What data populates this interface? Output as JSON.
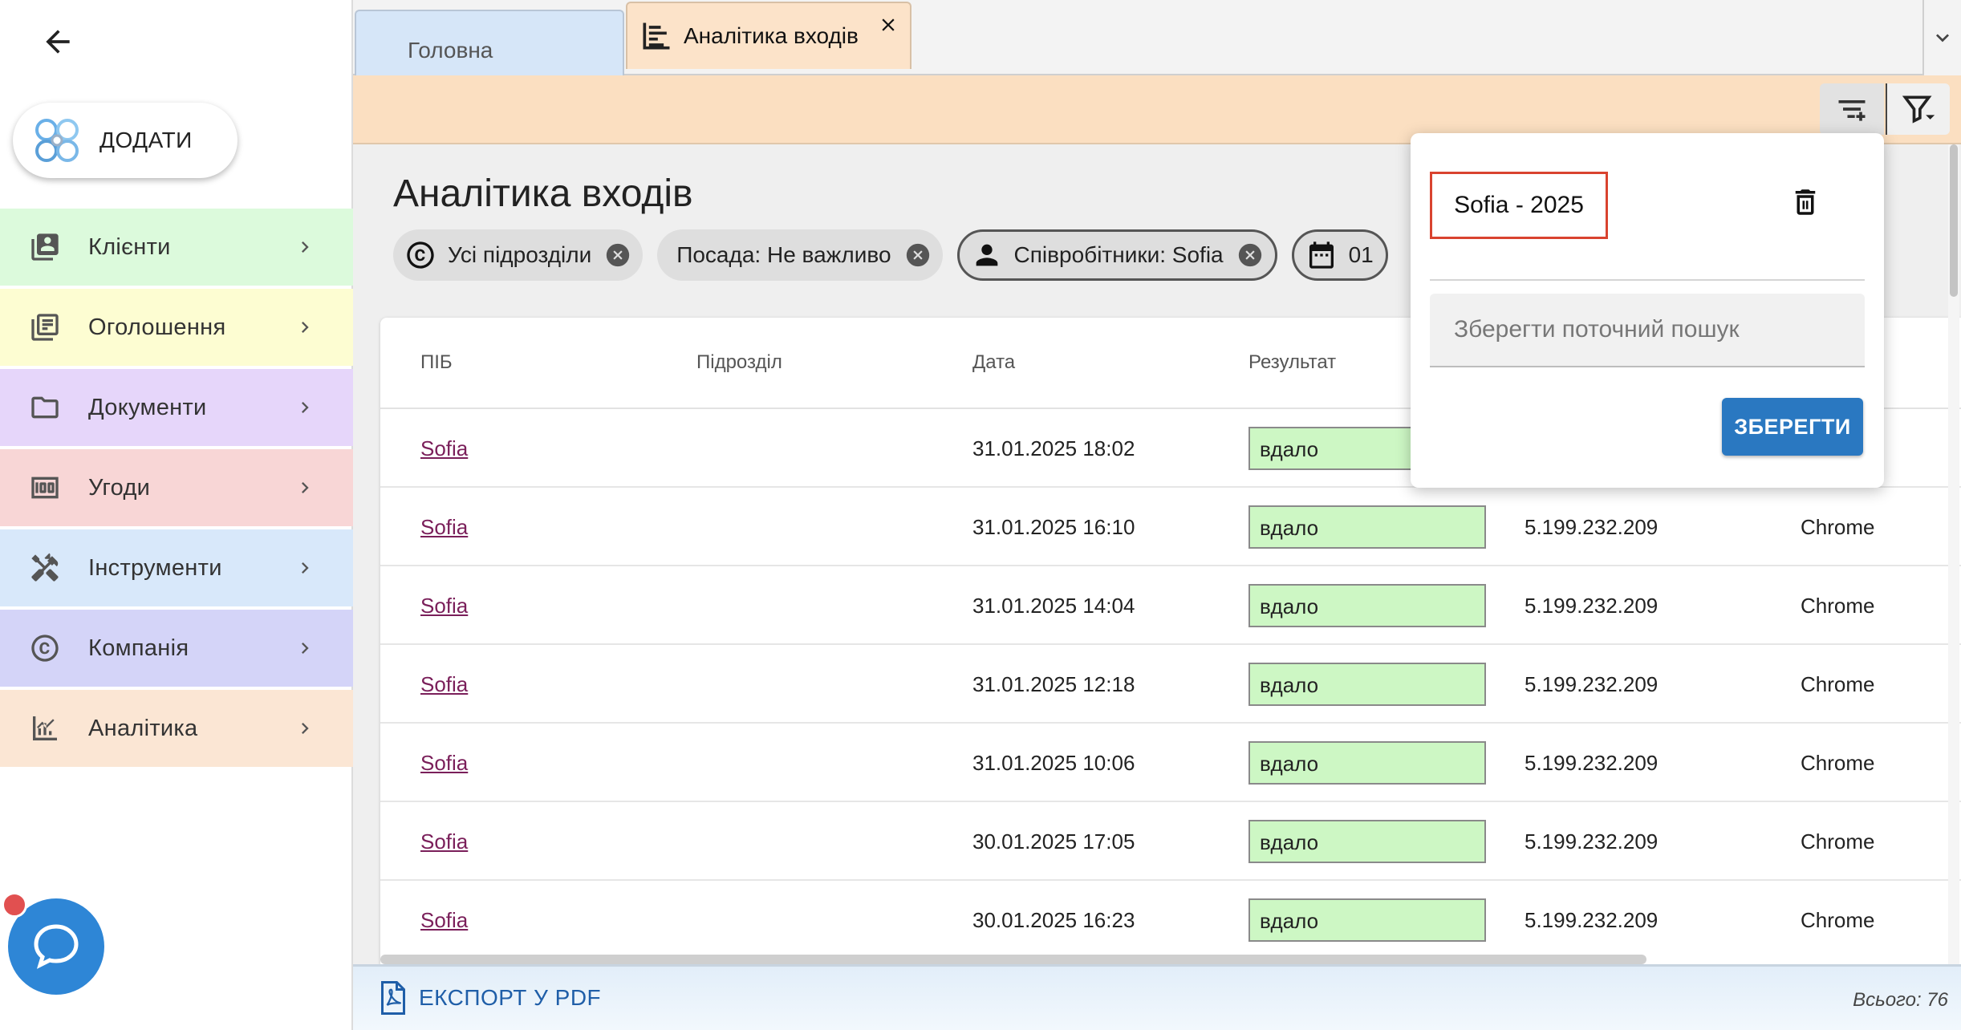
{
  "sidebar": {
    "add_label": "ДОДАТИ",
    "items": [
      {
        "label": "Клієнти",
        "icon": "contacts-icon",
        "bg": "#dcfadc"
      },
      {
        "label": "Оголошення",
        "icon": "listing-icon",
        "bg": "#fdfdd2"
      },
      {
        "label": "Документи",
        "icon": "folder-icon",
        "bg": "#e6d6fa"
      },
      {
        "label": "Угоди",
        "icon": "money-icon",
        "bg": "#f8d6d6"
      },
      {
        "label": "Інструменти",
        "icon": "tools-icon",
        "bg": "#d8e8fa"
      },
      {
        "label": "Компанія",
        "icon": "copyright-icon",
        "bg": "#d4d4f8"
      },
      {
        "label": "Аналітика",
        "icon": "analytics-icon",
        "bg": "#fbe6d4"
      }
    ]
  },
  "tabs": {
    "home_label": "Головна",
    "active_label": "Аналітика входів"
  },
  "page": {
    "title": "Аналітика входів",
    "chips": {
      "subdivisions": "Усі підрозділи",
      "position": "Посада: Не важливо",
      "employees": "Співробітники: Sofia",
      "date": "01"
    }
  },
  "table": {
    "columns": [
      "ПІБ",
      "Підрозділ",
      "Дата",
      "Результат"
    ],
    "rows": [
      {
        "name": "Sofia",
        "date": "31.01.2025 18:02",
        "result": "вдало",
        "ip": "",
        "browser": ""
      },
      {
        "name": "Sofia",
        "date": "31.01.2025 16:10",
        "result": "вдало",
        "ip": "5.199.232.209",
        "browser": "Chrome"
      },
      {
        "name": "Sofia",
        "date": "31.01.2025 14:04",
        "result": "вдало",
        "ip": "5.199.232.209",
        "browser": "Chrome"
      },
      {
        "name": "Sofia",
        "date": "31.01.2025 12:18",
        "result": "вдало",
        "ip": "5.199.232.209",
        "browser": "Chrome"
      },
      {
        "name": "Sofia",
        "date": "31.01.2025 10:06",
        "result": "вдало",
        "ip": "5.199.232.209",
        "browser": "Chrome"
      },
      {
        "name": "Sofia",
        "date": "30.01.2025 17:05",
        "result": "вдало",
        "ip": "5.199.232.209",
        "browser": "Chrome"
      },
      {
        "name": "Sofia",
        "date": "30.01.2025 16:23",
        "result": "вдало",
        "ip": "5.199.232.209",
        "browser": "Chrome"
      }
    ]
  },
  "footer": {
    "export_label": "ЕКСПОРТ У PDF",
    "total": "Всього: 76"
  },
  "popover": {
    "saved_search": "Sofia - 2025",
    "input_placeholder": "Зберегти поточний пошук",
    "save_label": "ЗБЕРЕГТИ"
  }
}
